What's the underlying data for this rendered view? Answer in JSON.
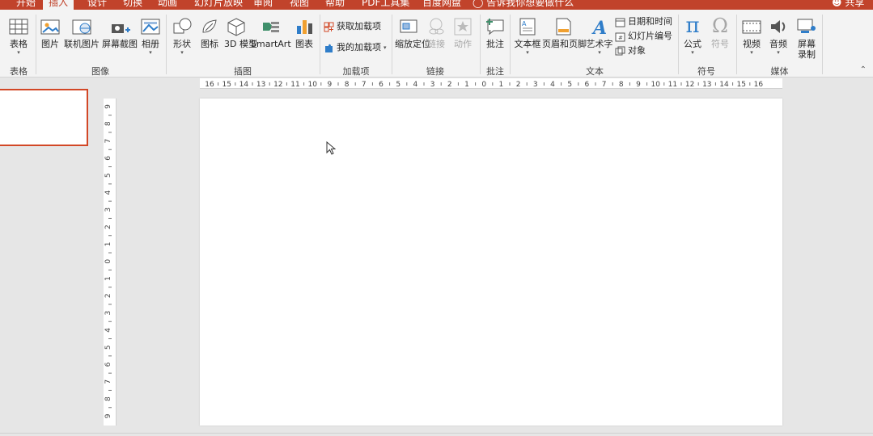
{
  "tabs": [
    "开始",
    "插入",
    "设计",
    "切换",
    "动画",
    "幻灯片放映",
    "审阅",
    "视图",
    "帮助",
    "PDF工具集",
    "百度网盘"
  ],
  "tell_me": "告诉我你想要做什么",
  "share": "共享",
  "ribbon": {
    "table": "表格",
    "picture": "图片",
    "online_picture": "联机图片",
    "screenshot": "屏幕截图",
    "photo_album": "相册",
    "shapes": "形状",
    "icons": "图标",
    "model_3d": "3D 模型",
    "smartart": "SmartArt",
    "chart": "图表",
    "get_addins": "获取加载项",
    "my_addins": "我的加载项",
    "zoom": "缩放定位",
    "link": "链接",
    "action": "动作",
    "comment": "批注",
    "textbox": "文本框",
    "header_footer": "页眉和页脚",
    "wordart": "艺术字",
    "date_time": "日期和时间",
    "slide_number": "幻灯片编号",
    "object": "对象",
    "equation": "公式",
    "symbol": "符号",
    "video": "视频",
    "audio": "音频",
    "screen_recording_1": "屏幕",
    "screen_recording_2": "录制"
  },
  "groups": {
    "tables": "表格",
    "images": "图像",
    "illustrations": "插图",
    "addins": "加载项",
    "links": "链接",
    "comments": "批注",
    "text": "文本",
    "symbols": "符号",
    "media": "媒体"
  },
  "ruler": {
    "h_labels": [
      "16",
      "15",
      "14",
      "13",
      "12",
      "11",
      "10",
      "9",
      "8",
      "7",
      "6",
      "5",
      "4",
      "3",
      "2",
      "1",
      "0",
      "1",
      "2",
      "3",
      "4",
      "5",
      "6",
      "7",
      "8",
      "9",
      "10",
      "11",
      "12",
      "13",
      "14",
      "15",
      "16"
    ],
    "v_labels": [
      "9",
      "8",
      "7",
      "6",
      "5",
      "4",
      "3",
      "2",
      "1",
      "0",
      "1",
      "2",
      "3",
      "4",
      "5",
      "6",
      "7",
      "8",
      "9"
    ]
  }
}
